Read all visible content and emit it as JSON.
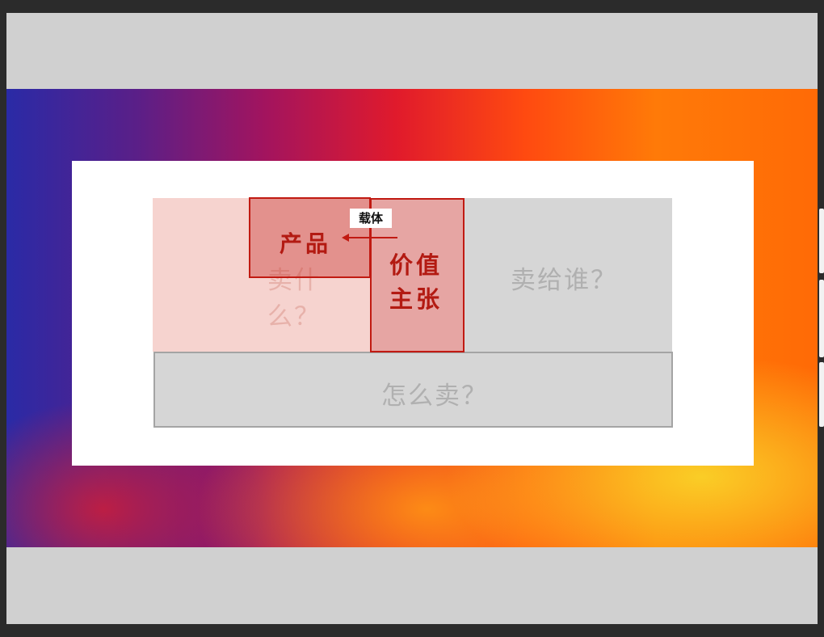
{
  "diagram": {
    "what_to_sell": "卖什么？",
    "to_whom": "卖给谁？",
    "how_to_sell": "怎么卖？",
    "product": "产品",
    "value_proposition_line1": "价值",
    "value_proposition_line2": "主张",
    "carrier": "载体"
  },
  "colors": {
    "accent_red": "#c11a12",
    "highlight_fill": "#f6d3cf",
    "neutral_fill": "#d6d6d6"
  }
}
